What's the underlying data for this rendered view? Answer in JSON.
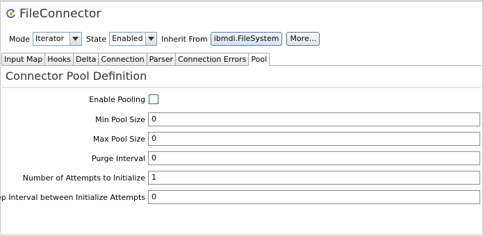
{
  "title": "FileConnector",
  "toolbar": {
    "mode_label": "Mode",
    "mode_value": "Iterator",
    "state_label": "State",
    "state_value": "Enabled",
    "inherit_label": "Inherit From",
    "inherit_value": "ibmdi.FileSystem",
    "more_label": "More..."
  },
  "tabs": [
    {
      "label": "Input Map"
    },
    {
      "label": "Hooks"
    },
    {
      "label": "Delta"
    },
    {
      "label": "Connection"
    },
    {
      "label": "Parser"
    },
    {
      "label": "Connection Errors"
    },
    {
      "label": "Pool",
      "active": true
    }
  ],
  "section": {
    "title": "Connector Pool Definition",
    "enable_pooling_label": "Enable Pooling",
    "enable_pooling_checked": false,
    "fields": [
      {
        "label": "Min Pool Size",
        "value": "0"
      },
      {
        "label": "Max Pool Size",
        "value": "0"
      },
      {
        "label": "Purge Interval",
        "value": "0"
      },
      {
        "label": "Number of Attempts to Initialize",
        "value": "1"
      },
      {
        "label": "Sleep Interval between Initialize Attempts",
        "value": "0"
      }
    ]
  },
  "icons": {
    "title_icon": "connector-refresh-icon",
    "combo_arrow": "chevron-down-icon"
  },
  "colors": {
    "title_text": "#333333",
    "checkbox_border": "#3b5e91",
    "tab_border": "#a9a9a9"
  }
}
